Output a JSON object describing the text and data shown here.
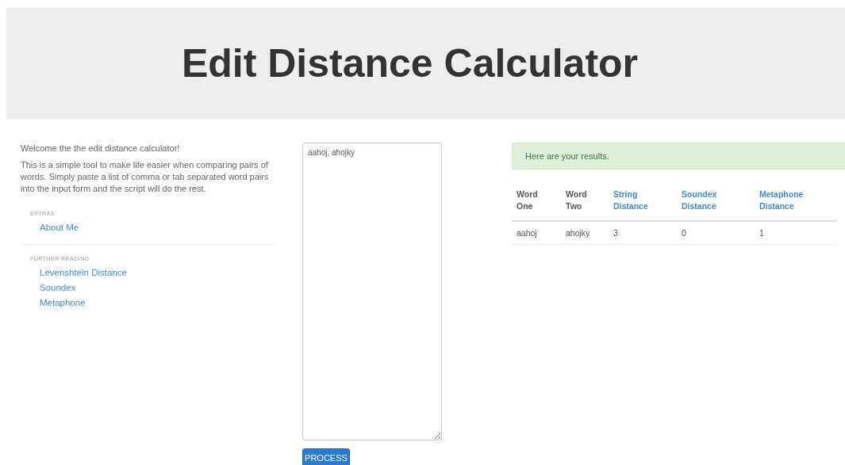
{
  "header": {
    "title": "Edit Distance Calculator"
  },
  "intro": {
    "welcome": "Welcome the the edit distance calculator!",
    "description": "This is a simple tool to make life easier when comparing pairs of words. Simply paste a list of comma or tab separated word pairs into the input form and the script will do the rest."
  },
  "nav_sections": [
    {
      "heading": "EXTRAS",
      "links": [
        "About Me"
      ]
    },
    {
      "heading": "FURTHER READING",
      "links": [
        "Levenshtein Distance",
        "Soundex",
        "Metaphone"
      ]
    }
  ],
  "input": {
    "value": "aahoj, ahojky"
  },
  "process_button": "PROCESS",
  "alert": "Here are your results.",
  "table": {
    "columns": [
      {
        "label": "Word One",
        "link": false
      },
      {
        "label": "Word Two",
        "link": false
      },
      {
        "label": "String Distance",
        "link": true
      },
      {
        "label": "Soundex Distance",
        "link": true
      },
      {
        "label": "Metaphone Distance",
        "link": true
      }
    ],
    "rows": [
      [
        "aahoj",
        "ahojky",
        "3",
        "0",
        "1"
      ]
    ]
  }
}
